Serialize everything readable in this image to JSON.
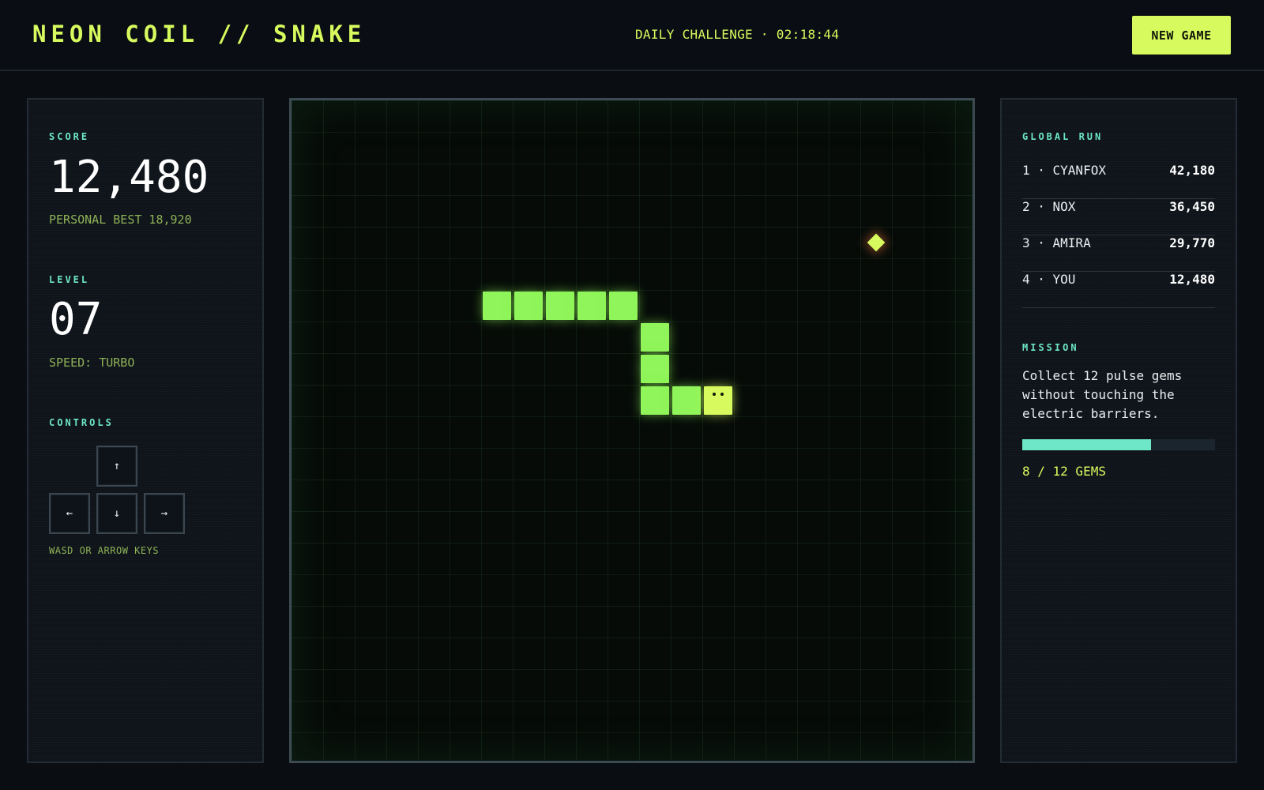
{
  "header": {
    "title": "NEON COIL // SNAKE",
    "challenge": "DAILY CHALLENGE · 02:18:44",
    "new_game_label": "NEW GAME"
  },
  "stats": {
    "score_label": "SCORE",
    "score": "12,480",
    "personal_best": "PERSONAL BEST 18,920",
    "level_label": "LEVEL",
    "level": "07",
    "speed": "SPEED: TURBO",
    "controls_label": "CONTROLS",
    "keys": {
      "up": "↑",
      "left": "←",
      "down": "↓",
      "right": "→"
    },
    "hint": "WASD OR ARROW KEYS"
  },
  "leaderboard": {
    "label": "GLOBAL RUN",
    "rows": [
      {
        "name": "1 · CYANFOX",
        "score": "42,180"
      },
      {
        "name": "2 · NOX",
        "score": "36,450"
      },
      {
        "name": "3 · AMIRA",
        "score": "29,770"
      },
      {
        "name": "4 · YOU",
        "score": "12,480"
      }
    ]
  },
  "mission": {
    "label": "MISSION",
    "text": "Collect 12 pulse gems without touching the electric barriers.",
    "progress": 0.6667,
    "gems_text": "8 / 12 GEMS"
  },
  "board": {
    "snake_cells": [
      [
        6,
        6
      ],
      [
        7,
        6
      ],
      [
        8,
        6
      ],
      [
        9,
        6
      ],
      [
        10,
        6
      ],
      [
        11,
        7
      ],
      [
        11,
        8
      ],
      [
        11,
        9
      ],
      [
        12,
        9
      ],
      [
        13,
        9
      ]
    ],
    "head_cell": [
      13,
      9
    ],
    "gem_cell": [
      18,
      4
    ]
  },
  "colors": {
    "accent": "#d7fb5e",
    "snake": "#8ff55a",
    "teal": "#6ee6c8",
    "background": "#0a0d12"
  }
}
